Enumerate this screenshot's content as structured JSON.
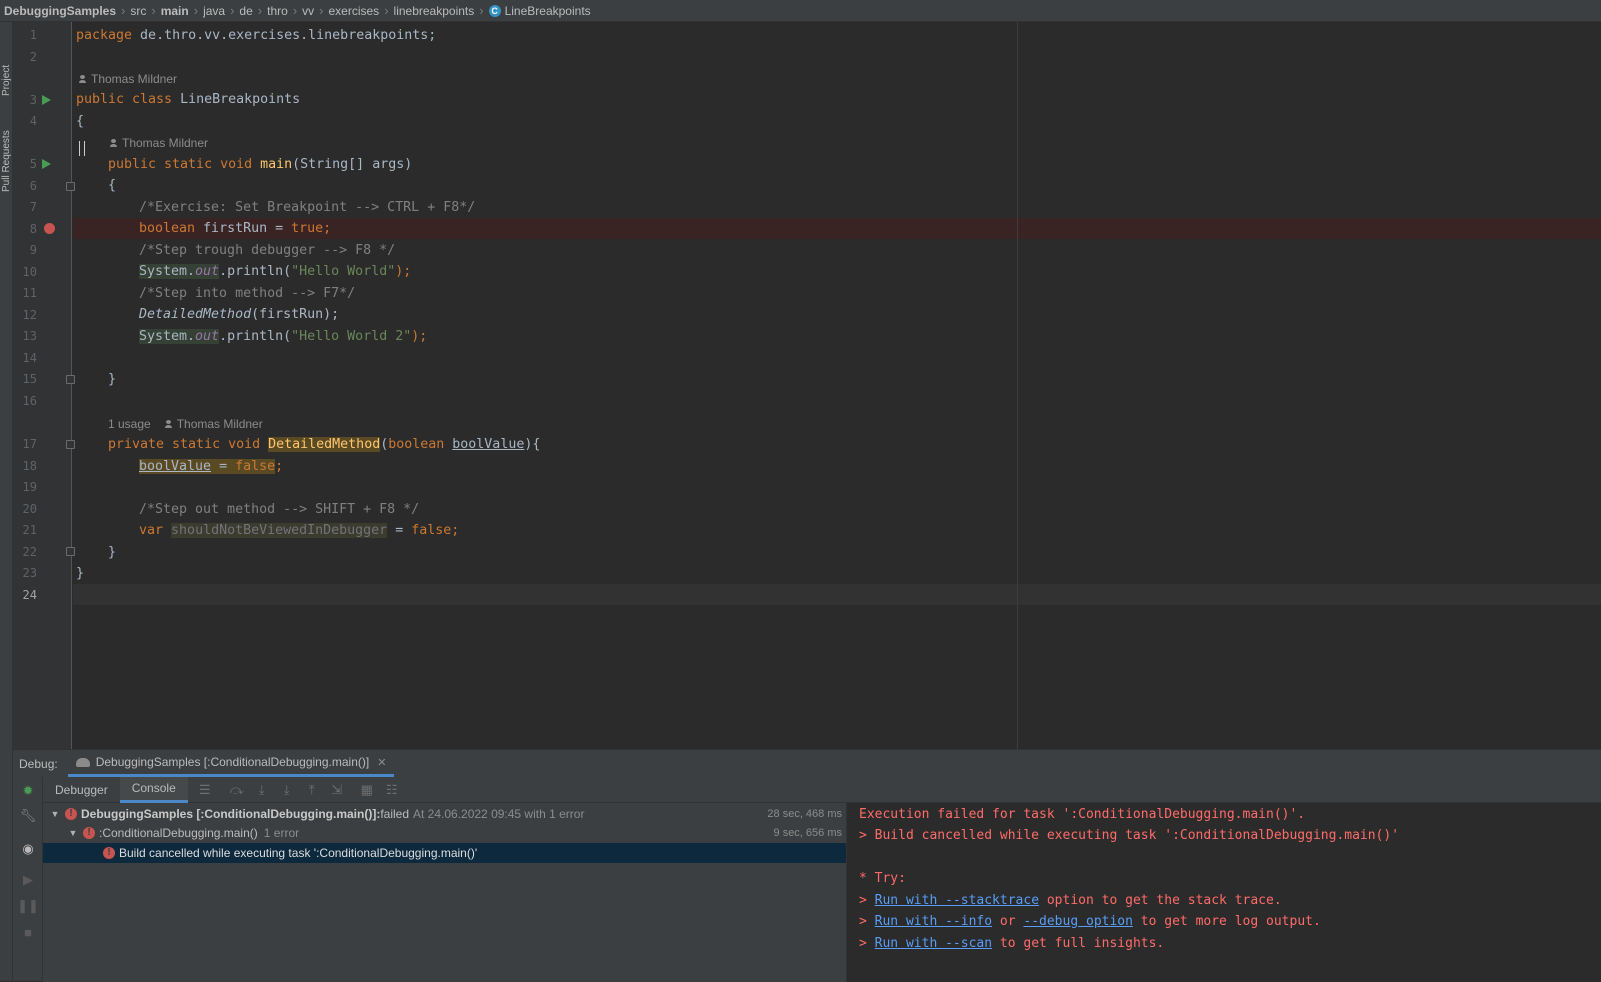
{
  "breadcrumb": {
    "items": [
      "DebuggingSamples",
      "src",
      "main",
      "java",
      "de",
      "thro",
      "vv",
      "exercises",
      "linebreakpoints",
      "LineBreakpoints"
    ]
  },
  "side_tabs": {
    "project": "Project",
    "pull_requests": "Pull Requests"
  },
  "editor": {
    "line_numbers": [
      "1",
      "2",
      "3",
      "4",
      "5",
      "6",
      "7",
      "8",
      "9",
      "10",
      "11",
      "12",
      "13",
      "14",
      "15",
      "16",
      "17",
      "18",
      "19",
      "20",
      "21",
      "22",
      "23",
      "24"
    ],
    "hints": {
      "author": "Thomas Mildner",
      "usages": "1 usage"
    },
    "code": {
      "l1_kw": "package",
      "l1_rest": " de.thro.vv.exercises.linebreakpoints;",
      "l3_kw": "public class",
      "l3_rest": " LineBreakpoints",
      "l4": "{",
      "l5_kw": "public static void",
      "l5_fn": " main",
      "l5_rest": "(String[] args)",
      "l6": "{",
      "l7": "/*Exercise: Set Breakpoint --> CTRL + F8*/",
      "l8_kw": "boolean",
      "l8_mid": " firstRun = ",
      "l8_val": "true",
      "l8_end": ";",
      "l9": "/*Step trough debugger --> F8 */",
      "l10_cls": "System.",
      "l10_fld": "out",
      "l10_call": ".println(",
      "l10_str": "\"Hello World\"",
      "l10_end": ");",
      "l11": "/*Step into method --> F7*/",
      "l12_fn": "DetailedMethod",
      "l12_rest": "(firstRun);",
      "l13_cls": "System.",
      "l13_fld": "out",
      "l13_call": ".println(",
      "l13_str": "\"Hello World 2\"",
      "l13_end": ");",
      "l15": "}",
      "l17_kw": "private static void",
      "l17_fn": "DetailedMethod",
      "l17_p1": "(",
      "l17_kw2": "boolean",
      "l17_param": "boolValue",
      "l17_end": "){",
      "l18_var": "boolValue",
      "l18_mid": " = ",
      "l18_val": "false",
      "l18_end": ";",
      "l20": "/*Step out method --> SHIFT + F8 */",
      "l21_kw": "var",
      "l21_var": "shouldNotBeViewedInDebugger",
      "l21_mid": " = ",
      "l21_val": "false",
      "l21_end": ";",
      "l22": "}",
      "l23": "}"
    }
  },
  "debug": {
    "label": "Debug:",
    "session_tab": "DebuggingSamples [:ConditionalDebugging.main()]",
    "tabs": [
      "Debugger",
      "Console"
    ],
    "active_tab": "Console",
    "tree": {
      "root_title": "DebuggingSamples [:ConditionalDebugging.main()]:",
      "root_status": " failed",
      "root_detail": "At 24.06.2022 09:45 with 1 error",
      "root_time": "28 sec, 468 ms",
      "task_title": ":ConditionalDebugging.main()",
      "task_detail": "1 error",
      "task_time": "9 sec, 656 ms",
      "error_msg": "Build cancelled while executing task ':ConditionalDebugging.main()'"
    },
    "console": {
      "line1": "Execution failed for task ':ConditionalDebugging.main()'.",
      "line2": "> Build cancelled while executing task ':ConditionalDebugging.main()'",
      "try": "* Try:",
      "prompt": "> ",
      "link_stacktrace": "Run with --stacktrace",
      "text_stacktrace": " option to get the stack trace.",
      "link_info": "Run with --info",
      "text_or": " or ",
      "link_debug": "--debug option",
      "text_info": " to get more log output.",
      "link_scan": "Run with --scan",
      "text_scan": " to get full insights."
    }
  },
  "colors": {
    "keyword": "#cc7832",
    "comment": "#808080",
    "string": "#6a8759",
    "field": "#9876aa",
    "function": "#ffc66d",
    "breakpoint": "#c75450",
    "error_text": "#ff6b68",
    "link": "#589df6"
  }
}
